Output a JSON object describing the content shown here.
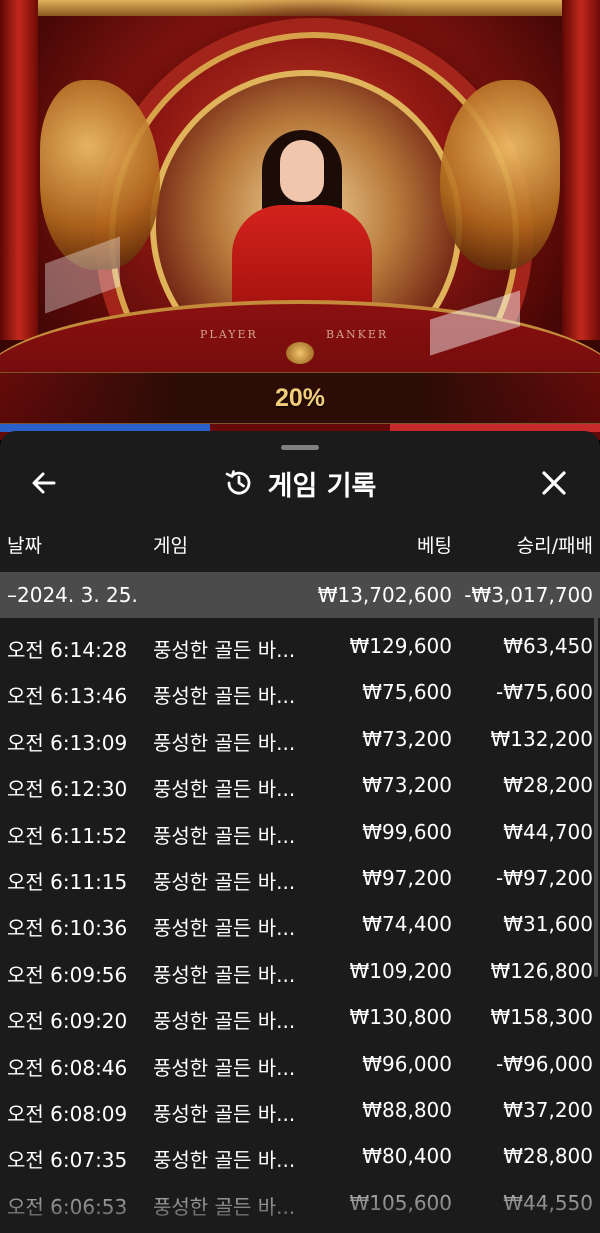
{
  "scene": {
    "table_labels": [
      "PLAYER",
      "BANKER"
    ],
    "percent": "20%"
  },
  "history": {
    "title": "게임 기록",
    "icons": {
      "back": "arrow-left-icon",
      "title": "history-clock-icon",
      "close": "close-icon"
    },
    "columns": {
      "date": "날짜",
      "game": "게임",
      "bet": "베팅",
      "win_loss": "승리/패배"
    },
    "summary": {
      "date": "–2024. 3. 25.",
      "bet": "₩13,702,600",
      "win_loss": "-₩3,017,700"
    },
    "rows": [
      {
        "time": "오전 6:14:28",
        "game": "풍성한 골든 바...",
        "bet": "₩129,600",
        "win_loss": "₩63,450"
      },
      {
        "time": "오전 6:13:46",
        "game": "풍성한 골든 바...",
        "bet": "₩75,600",
        "win_loss": "-₩75,600"
      },
      {
        "time": "오전 6:13:09",
        "game": "풍성한 골든 바...",
        "bet": "₩73,200",
        "win_loss": "₩132,200"
      },
      {
        "time": "오전 6:12:30",
        "game": "풍성한 골든 바...",
        "bet": "₩73,200",
        "win_loss": "₩28,200"
      },
      {
        "time": "오전 6:11:52",
        "game": "풍성한 골든 바...",
        "bet": "₩99,600",
        "win_loss": "₩44,700"
      },
      {
        "time": "오전 6:11:15",
        "game": "풍성한 골든 바...",
        "bet": "₩97,200",
        "win_loss": "-₩97,200"
      },
      {
        "time": "오전 6:10:36",
        "game": "풍성한 골든 바...",
        "bet": "₩74,400",
        "win_loss": "₩31,600"
      },
      {
        "time": "오전 6:09:56",
        "game": "풍성한 골든 바...",
        "bet": "₩109,200",
        "win_loss": "₩126,800"
      },
      {
        "time": "오전 6:09:20",
        "game": "풍성한 골든 바...",
        "bet": "₩130,800",
        "win_loss": "₩158,300"
      },
      {
        "time": "오전 6:08:46",
        "game": "풍성한 골든 바...",
        "bet": "₩96,000",
        "win_loss": "-₩96,000"
      },
      {
        "time": "오전 6:08:09",
        "game": "풍성한 골든 바...",
        "bet": "₩88,800",
        "win_loss": "₩37,200"
      },
      {
        "time": "오전 6:07:35",
        "game": "풍성한 골든 바...",
        "bet": "₩80,400",
        "win_loss": "₩28,800"
      },
      {
        "time": "오전 6:06:53",
        "game": "풍성한 골든 바...",
        "bet": "₩105,600",
        "win_loss": "₩44,550"
      }
    ]
  },
  "colors": {
    "sheet_bg": "#1b1b1b",
    "summary_bg": "#4b4b4b",
    "percent_gold": "#f1cd7a"
  }
}
